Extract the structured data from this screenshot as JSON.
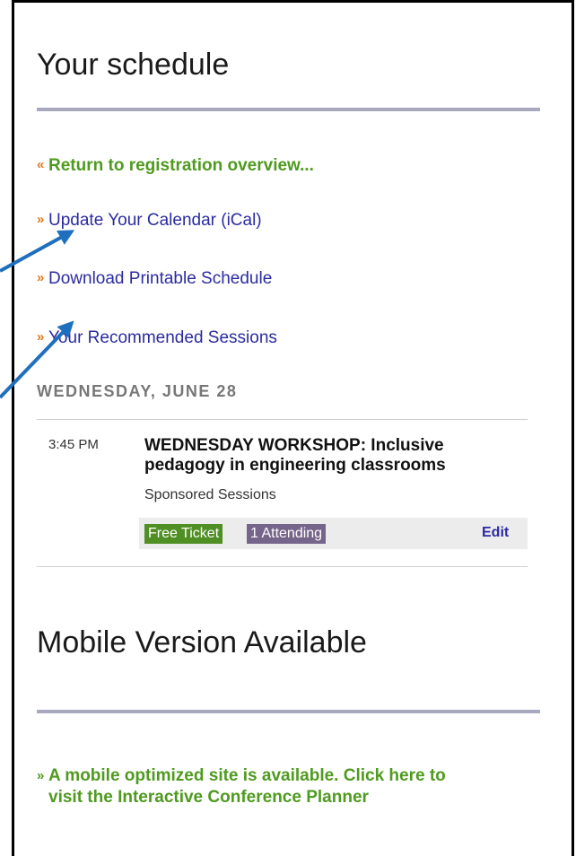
{
  "schedule": {
    "title": "Your schedule",
    "links": [
      {
        "label": "Return to registration overview...",
        "marker": "«"
      },
      {
        "label": "Update Your Calendar (iCal)",
        "marker": "»"
      },
      {
        "label": "Download Printable Schedule",
        "marker": "»"
      },
      {
        "label": "Your Recommended Sessions",
        "marker": "»"
      }
    ],
    "day": "WEDNESDAY, JUNE 28",
    "session": {
      "time": "3:45 PM",
      "title": "WEDNESDAY WORKSHOP: Inclusive pedagogy in engineering classrooms",
      "track": "Sponsored Sessions",
      "ticket_badge": "Free Ticket",
      "attending_badge": "1 Attending",
      "edit_label": "Edit"
    }
  },
  "mobile": {
    "title": "Mobile Version Available",
    "marker": "»",
    "link_label": "A mobile optimized site is available. Click here to visit the Interactive Conference Planner"
  },
  "colors": {
    "green_link": "#4f9a1f",
    "blue_link": "#2b2ba1",
    "marker_orange": "#e07a1a",
    "rule": "#a8a8bf",
    "badge_green": "#4f8f23",
    "badge_purple": "#76658a",
    "annotation_arrow": "#1f6fbf"
  }
}
